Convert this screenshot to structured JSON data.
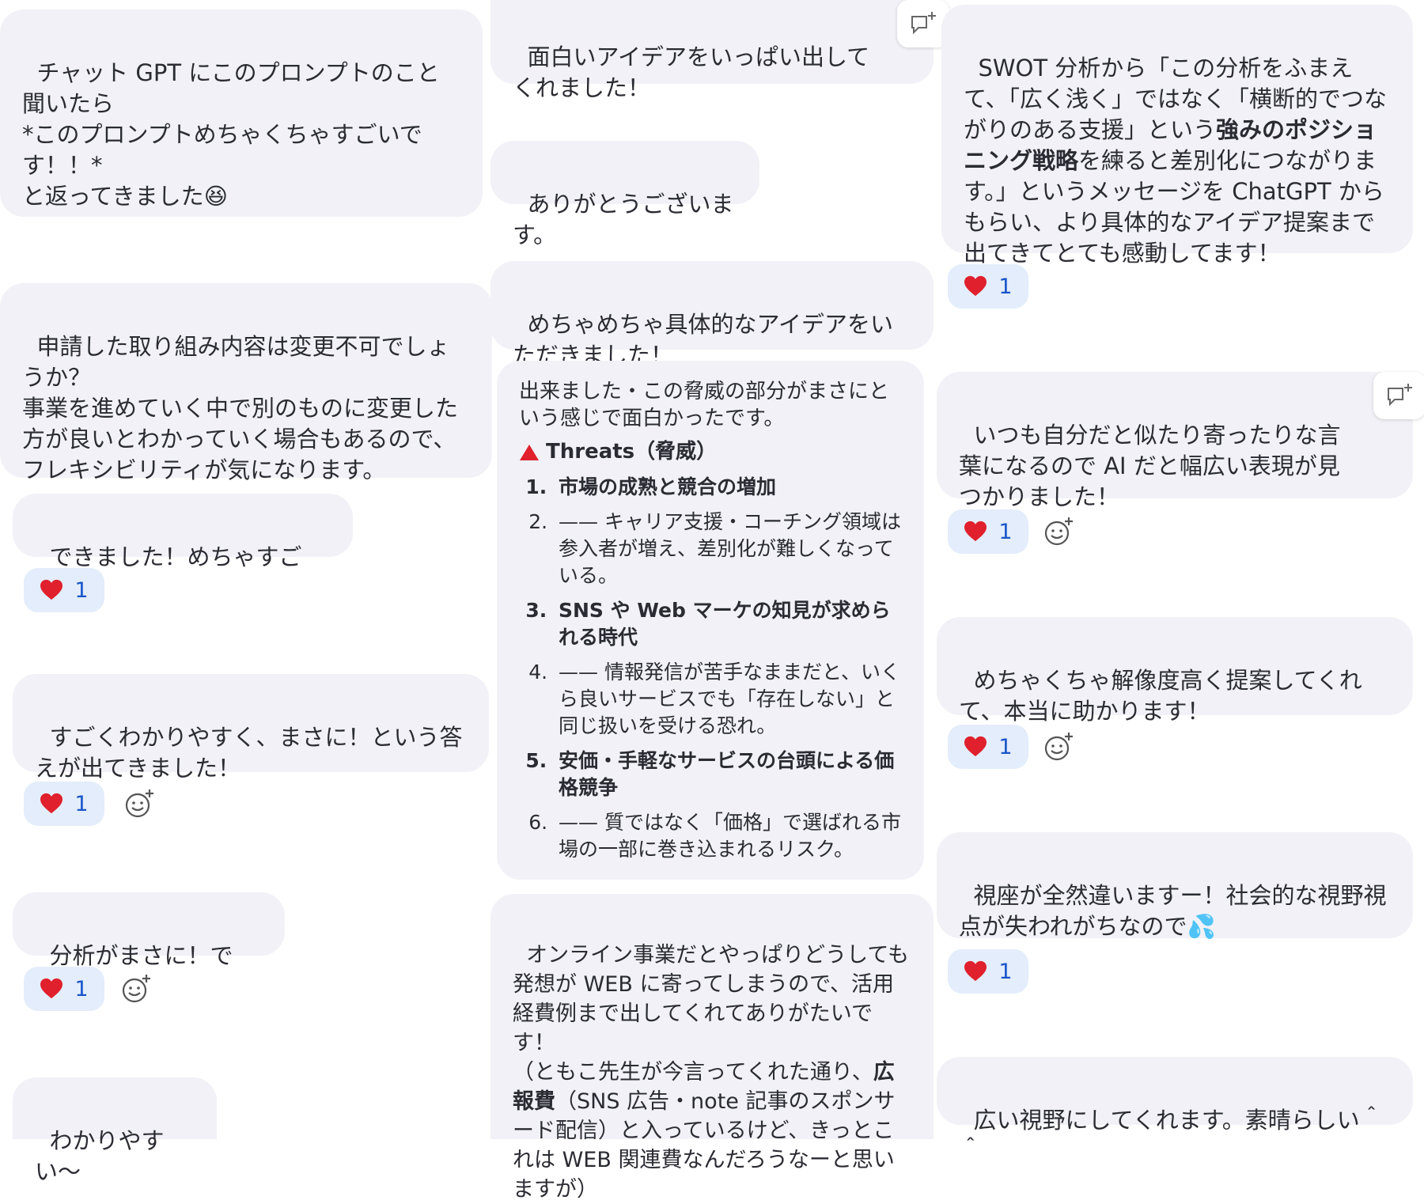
{
  "colors": {
    "bubble": "#f1f1f7",
    "reaction_bg": "#e3edfb",
    "reaction_count": "#1a55c8",
    "heart": "#e0202c"
  },
  "icons": {
    "heart": "heart-icon",
    "add_reaction": "add-reaction-icon",
    "thread": "reply-thread-icon",
    "triangle": "red-triangle-icon"
  },
  "left": {
    "m1": "チャット GPT にこのプロンプトのこと聞いたら\n*このプロンプトめちゃくちゃすごいです！！*\nと返ってきました",
    "m1_emoji": "😆",
    "m2": "申請した取り組み内容は変更不可でしょうか？\n事業を進めていく中で別のものに変更した方が良いとわかっていく場合もあるので、フレキシビリティが気になります。",
    "m3": "できました！めちゃすごい！",
    "m3_count": "1",
    "m4": "すごくわかりやすく、まさに！という答えが出てきました！",
    "m4_count": "1",
    "m5": "分析がまさに！です！",
    "m5_count": "1",
    "m6": "わかりやすい〜"
  },
  "middle": {
    "m1": "面白いアイデアをいっぱい出してくれました！",
    "m2": "ありがとうございます。",
    "m3": "めちゃめちゃ具体的なアイデアをいただきました！",
    "m4_intro": "出来ました・この脅威の部分がまさにという感じで面白かったです。",
    "m4_heading": "Threats（脅威）",
    "m4_items": [
      "市場の成熟と競合の増加",
      "—— キャリア支援・コーチング領域は参入者が増え、差別化が難しくなっている。",
      "SNS や Web マーケの知見が求められる時代",
      "—— 情報発信が苦手なままだと、いくら良いサービスでも「存在しない」と同じ扱いを受ける恐れ。",
      "安価・手軽なサービスの台頭による価格競争",
      "—— 質ではなく「価格」で選ばれる市場の一部に巻き込まれるリスク。"
    ],
    "m5_a": "オンライン事業だとやっぱりどうしても発想が WEB に寄ってしまうので、活用経費例まで出してくれてありがたいです！\n（ともこ先生が今言ってくれた通り、",
    "m5_b": "広報費",
    "m5_c": "（SNS 広告・note 記事のスポンサード配信）と入っているけど、きっとこれは WEB 関連費なんだろうなーと思いますが）"
  },
  "right": {
    "m1_a": "SWOT 分析から「この分析をふまえて、「広く浅く」ではなく「横断的でつながりのある支援」という",
    "m1_b": "強みのポジショニング戦略",
    "m1_c": "を練ると差別化につながります。」というメッセージを ChatGPT からもらい、より具体的なアイデア提案まで出てきてとても感動してます！",
    "m1_count": "1",
    "m2": "いつも自分だと似たり寄ったりな言葉になるので AI だと幅広い表現が見つかりました！",
    "m2_count": "1",
    "m3": "めちゃくちゃ解像度高く提案してくれて、本当に助かります！",
    "m3_count": "1",
    "m4": "視座が全然違いますー！社会的な視野視点が失われがちなので",
    "m4_emoji": "💦",
    "m4_count": "1",
    "m5": "広い視野にしてくれます。素晴らしい＾＾"
  }
}
